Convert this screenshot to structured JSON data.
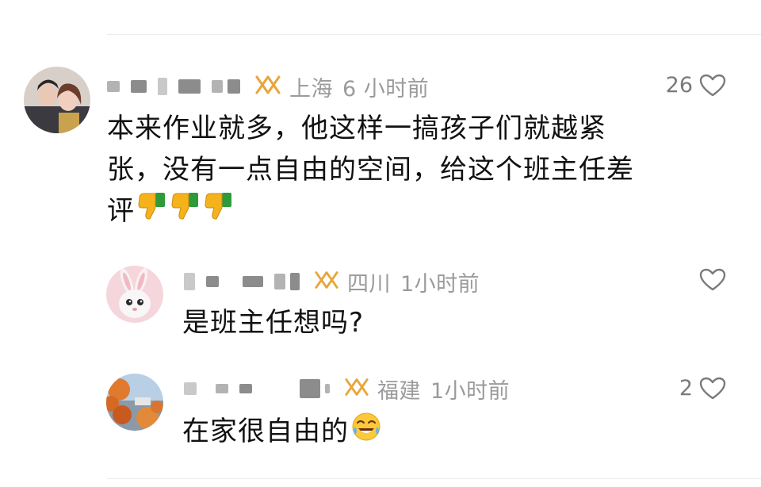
{
  "comments": [
    {
      "location": "上海",
      "time": "6 小时前",
      "likes": "26",
      "text_lines": [
        "本来作业就多，他这样一搞孩子们就越紧",
        "张，没有一点自由的空间，给这个班主任差",
        "评"
      ],
      "emoji": [
        "thumbs-down-icon",
        "thumbs-down-icon",
        "thumbs-down-icon"
      ]
    },
    {
      "location": "四川",
      "time": "1小时前",
      "likes": "",
      "text": "是班主任想吗?"
    },
    {
      "location": "福建",
      "time": "1小时前",
      "likes": "2",
      "text": "在家很自由的",
      "emoji": [
        "crying-laughing-icon"
      ]
    }
  ],
  "colors": {
    "meta": "#9b9b9b",
    "badge": "#e8a53a",
    "like_icon": "#7a7a7a",
    "thumb": "#f6b21b",
    "cuff": "#2e9a3a"
  }
}
